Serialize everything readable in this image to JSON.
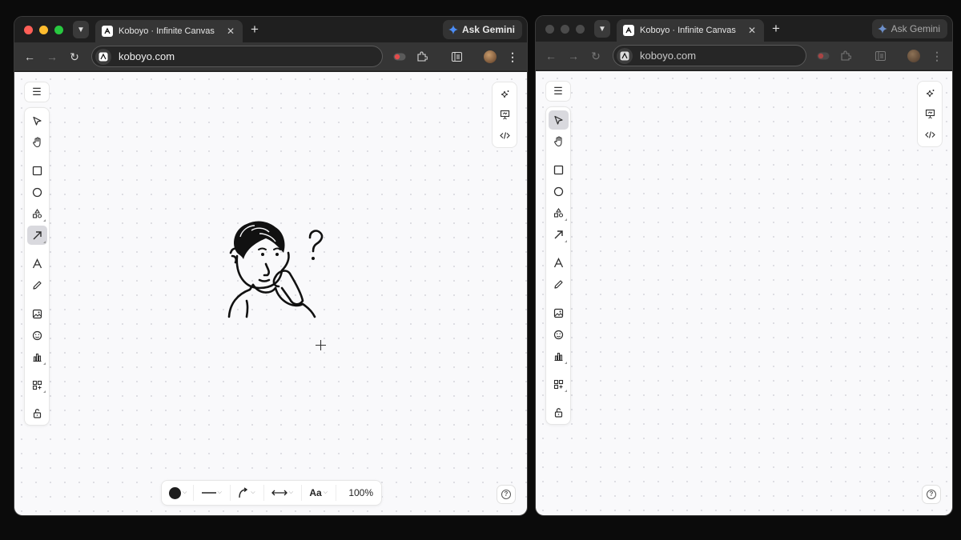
{
  "windows": {
    "left": {
      "tab_title": "Koboyo · Infinite Canvas",
      "url": "koboyo.com",
      "gemini_label": "Ask Gemini",
      "active_tool": "arrow",
      "bottom_bar": {
        "zoom": "100%",
        "font_label": "Aa",
        "stroke_color": "#1e1e1e"
      }
    },
    "right": {
      "tab_title": "Koboyo · Infinite Canvas",
      "url": "koboyo.com",
      "gemini_label": "Ask Gemini",
      "active_tool": "select"
    }
  },
  "icons": {
    "traffic_lights": [
      "#ff5f57",
      "#febc2e",
      "#28c840"
    ],
    "toolbar": [
      "select-icon",
      "hand-icon",
      "rectangle-icon",
      "ellipse-icon",
      "shapes-icon",
      "arrow-icon",
      "text-icon",
      "pencil-icon",
      "image-icon",
      "emoji-icon",
      "chart-icon",
      "widgets-icon",
      "lock-icon"
    ],
    "right_panel": [
      "ai-sparkle-icon",
      "presentation-icon",
      "code-icon"
    ]
  }
}
